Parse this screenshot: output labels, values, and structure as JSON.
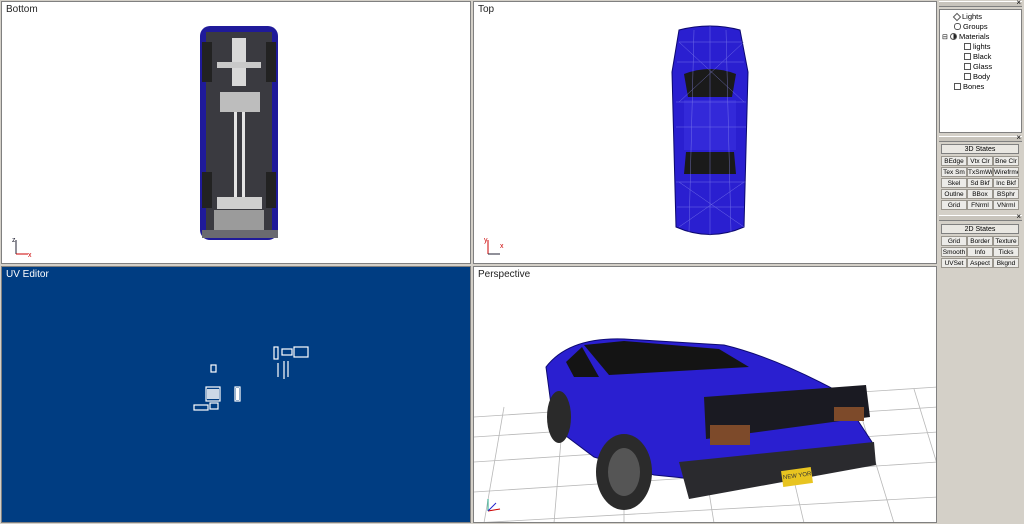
{
  "viewports": {
    "bottom": {
      "title": "Bottom"
    },
    "top": {
      "title": "Top"
    },
    "uv": {
      "title": "UV Editor"
    },
    "perspective": {
      "title": "Perspective"
    }
  },
  "tree": {
    "items": [
      {
        "label": "Lights"
      },
      {
        "label": "Groups"
      },
      {
        "label": "Materials"
      },
      {
        "label": "lights"
      },
      {
        "label": "Black"
      },
      {
        "label": "Glass"
      },
      {
        "label": "Body"
      },
      {
        "label": "Bones"
      }
    ]
  },
  "states3d": {
    "title": "3D States",
    "buttons": [
      "BEdge",
      "Vtx Clr",
      "Bne Clr",
      "Tex Sm",
      "TxSmWr",
      "Wirefrme",
      "Skel",
      "Sd Bkf",
      "Inc Bkf",
      "Outlne",
      "BBox",
      "BSphr",
      "Grid",
      "FNrml",
      "VNrml"
    ]
  },
  "states2d": {
    "title": "2D States",
    "buttons": [
      "Grid",
      "Border",
      "Texture",
      "Smooth",
      "Info",
      "Ticks",
      "UVSet",
      "Aspect",
      "Bkgnd"
    ]
  },
  "plate": {
    "text": "NEW YORK"
  },
  "close_glyph": "×",
  "colors": {
    "car_body": "#2a1fd0",
    "uv_bg": "#003d82",
    "panel_bg": "#d4d0c8"
  }
}
